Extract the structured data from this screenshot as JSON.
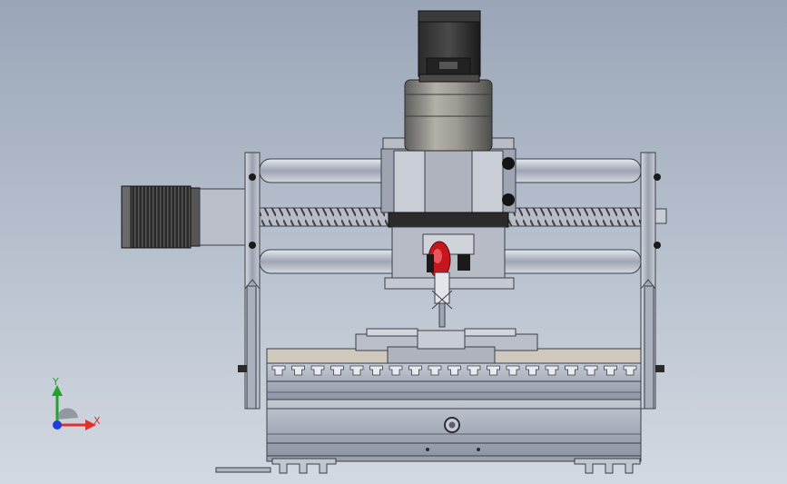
{
  "triad": {
    "x_label": "X",
    "y_label": "Y",
    "label_color": "#e0302a",
    "y_label_color": "#1fa32b"
  },
  "icons": [
    "axis-triad-icon"
  ],
  "colors": {
    "background_top": "#9aa6b8",
    "background_bottom": "#d3d9e2",
    "motor_black": "#1c1c1c",
    "metal": "#a7adbb",
    "highlight_red": "#c4161c"
  }
}
